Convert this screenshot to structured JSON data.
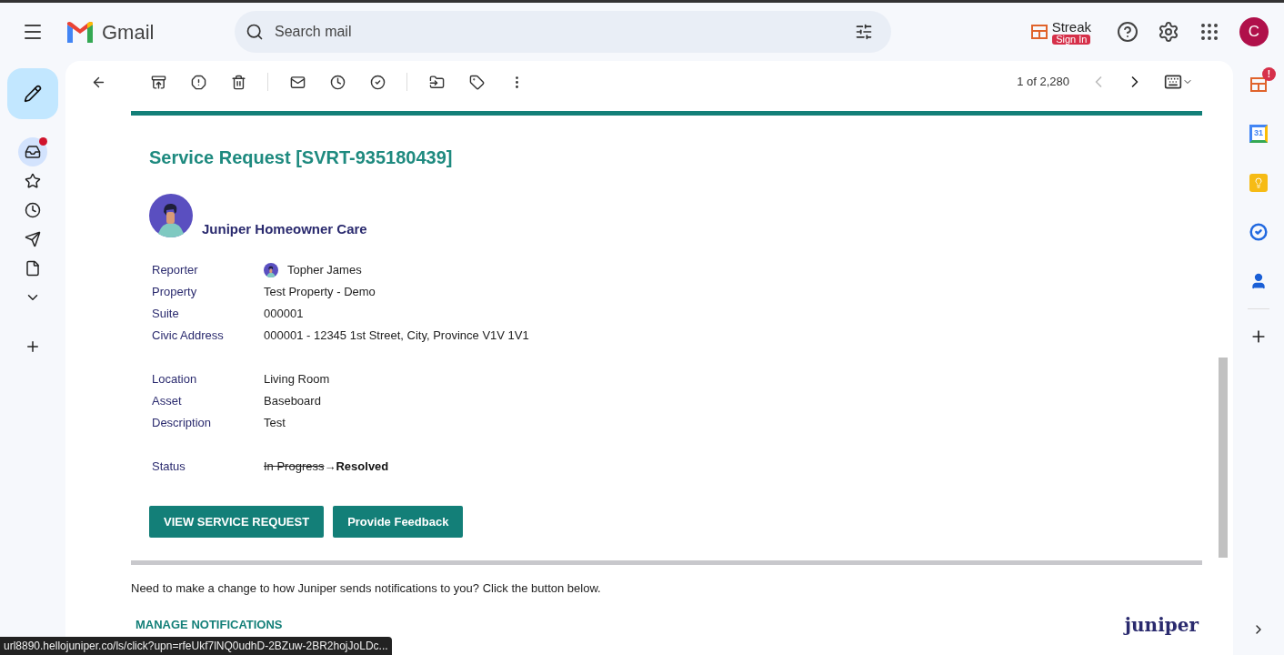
{
  "app": {
    "name": "Gmail",
    "account_initial": "C"
  },
  "search": {
    "placeholder": "Search mail"
  },
  "streak": {
    "label": "Streak",
    "badge": "Sign In"
  },
  "pager": {
    "label": "1 of 2,280"
  },
  "sidebar": {
    "items": [
      {
        "kind": "inbox",
        "selected": true,
        "unread": true
      },
      {
        "kind": "star",
        "selected": false,
        "unread": false
      },
      {
        "kind": "clock",
        "selected": false,
        "unread": false
      },
      {
        "kind": "send",
        "selected": false,
        "unread": false
      },
      {
        "kind": "file",
        "selected": false,
        "unread": false
      },
      {
        "kind": "more",
        "selected": false,
        "unread": false
      },
      {
        "kind": "plus",
        "selected": false,
        "unread": false
      }
    ]
  },
  "side_panel": {
    "streak_badge": "!",
    "calendar_day": "31"
  },
  "email": {
    "title": "Service Request [SVRT-935180439]",
    "sender": "Juniper Homeowner Care",
    "detail_groups": [
      [
        {
          "kind": "person",
          "label": "Reporter",
          "value": "Topher James"
        },
        {
          "kind": "text",
          "label": "Property",
          "value": "Test Property - Demo"
        },
        {
          "kind": "text",
          "label": "Suite",
          "value": "000001"
        },
        {
          "kind": "text",
          "label": "Civic Address",
          "value": "000001 - 12345 1st Street, City, Province V1V 1V1"
        }
      ],
      [
        {
          "kind": "text",
          "label": "Location",
          "value": "Living Room"
        },
        {
          "kind": "text",
          "label": "Asset",
          "value": "Baseboard"
        },
        {
          "kind": "text",
          "label": "Description",
          "value": "Test"
        }
      ],
      [
        {
          "kind": "status_change",
          "label": "Status",
          "old_value": "In Progress",
          "arrow": "→",
          "value": "Resolved"
        }
      ]
    ],
    "buttons": [
      "VIEW SERVICE REQUEST",
      "Provide Feedback"
    ],
    "notice": "Need to make a change to how Juniper sends notifications to you? Click the button below.",
    "manage_link": "MANAGE NOTIFICATIONS",
    "logo": "juniper"
  },
  "status_bar": {
    "url": "url8890.hellojuniper.co/ls/click?upn=rfeUkf7lNQ0udhD-2BZuw-2BR2hojJoLDc..."
  }
}
